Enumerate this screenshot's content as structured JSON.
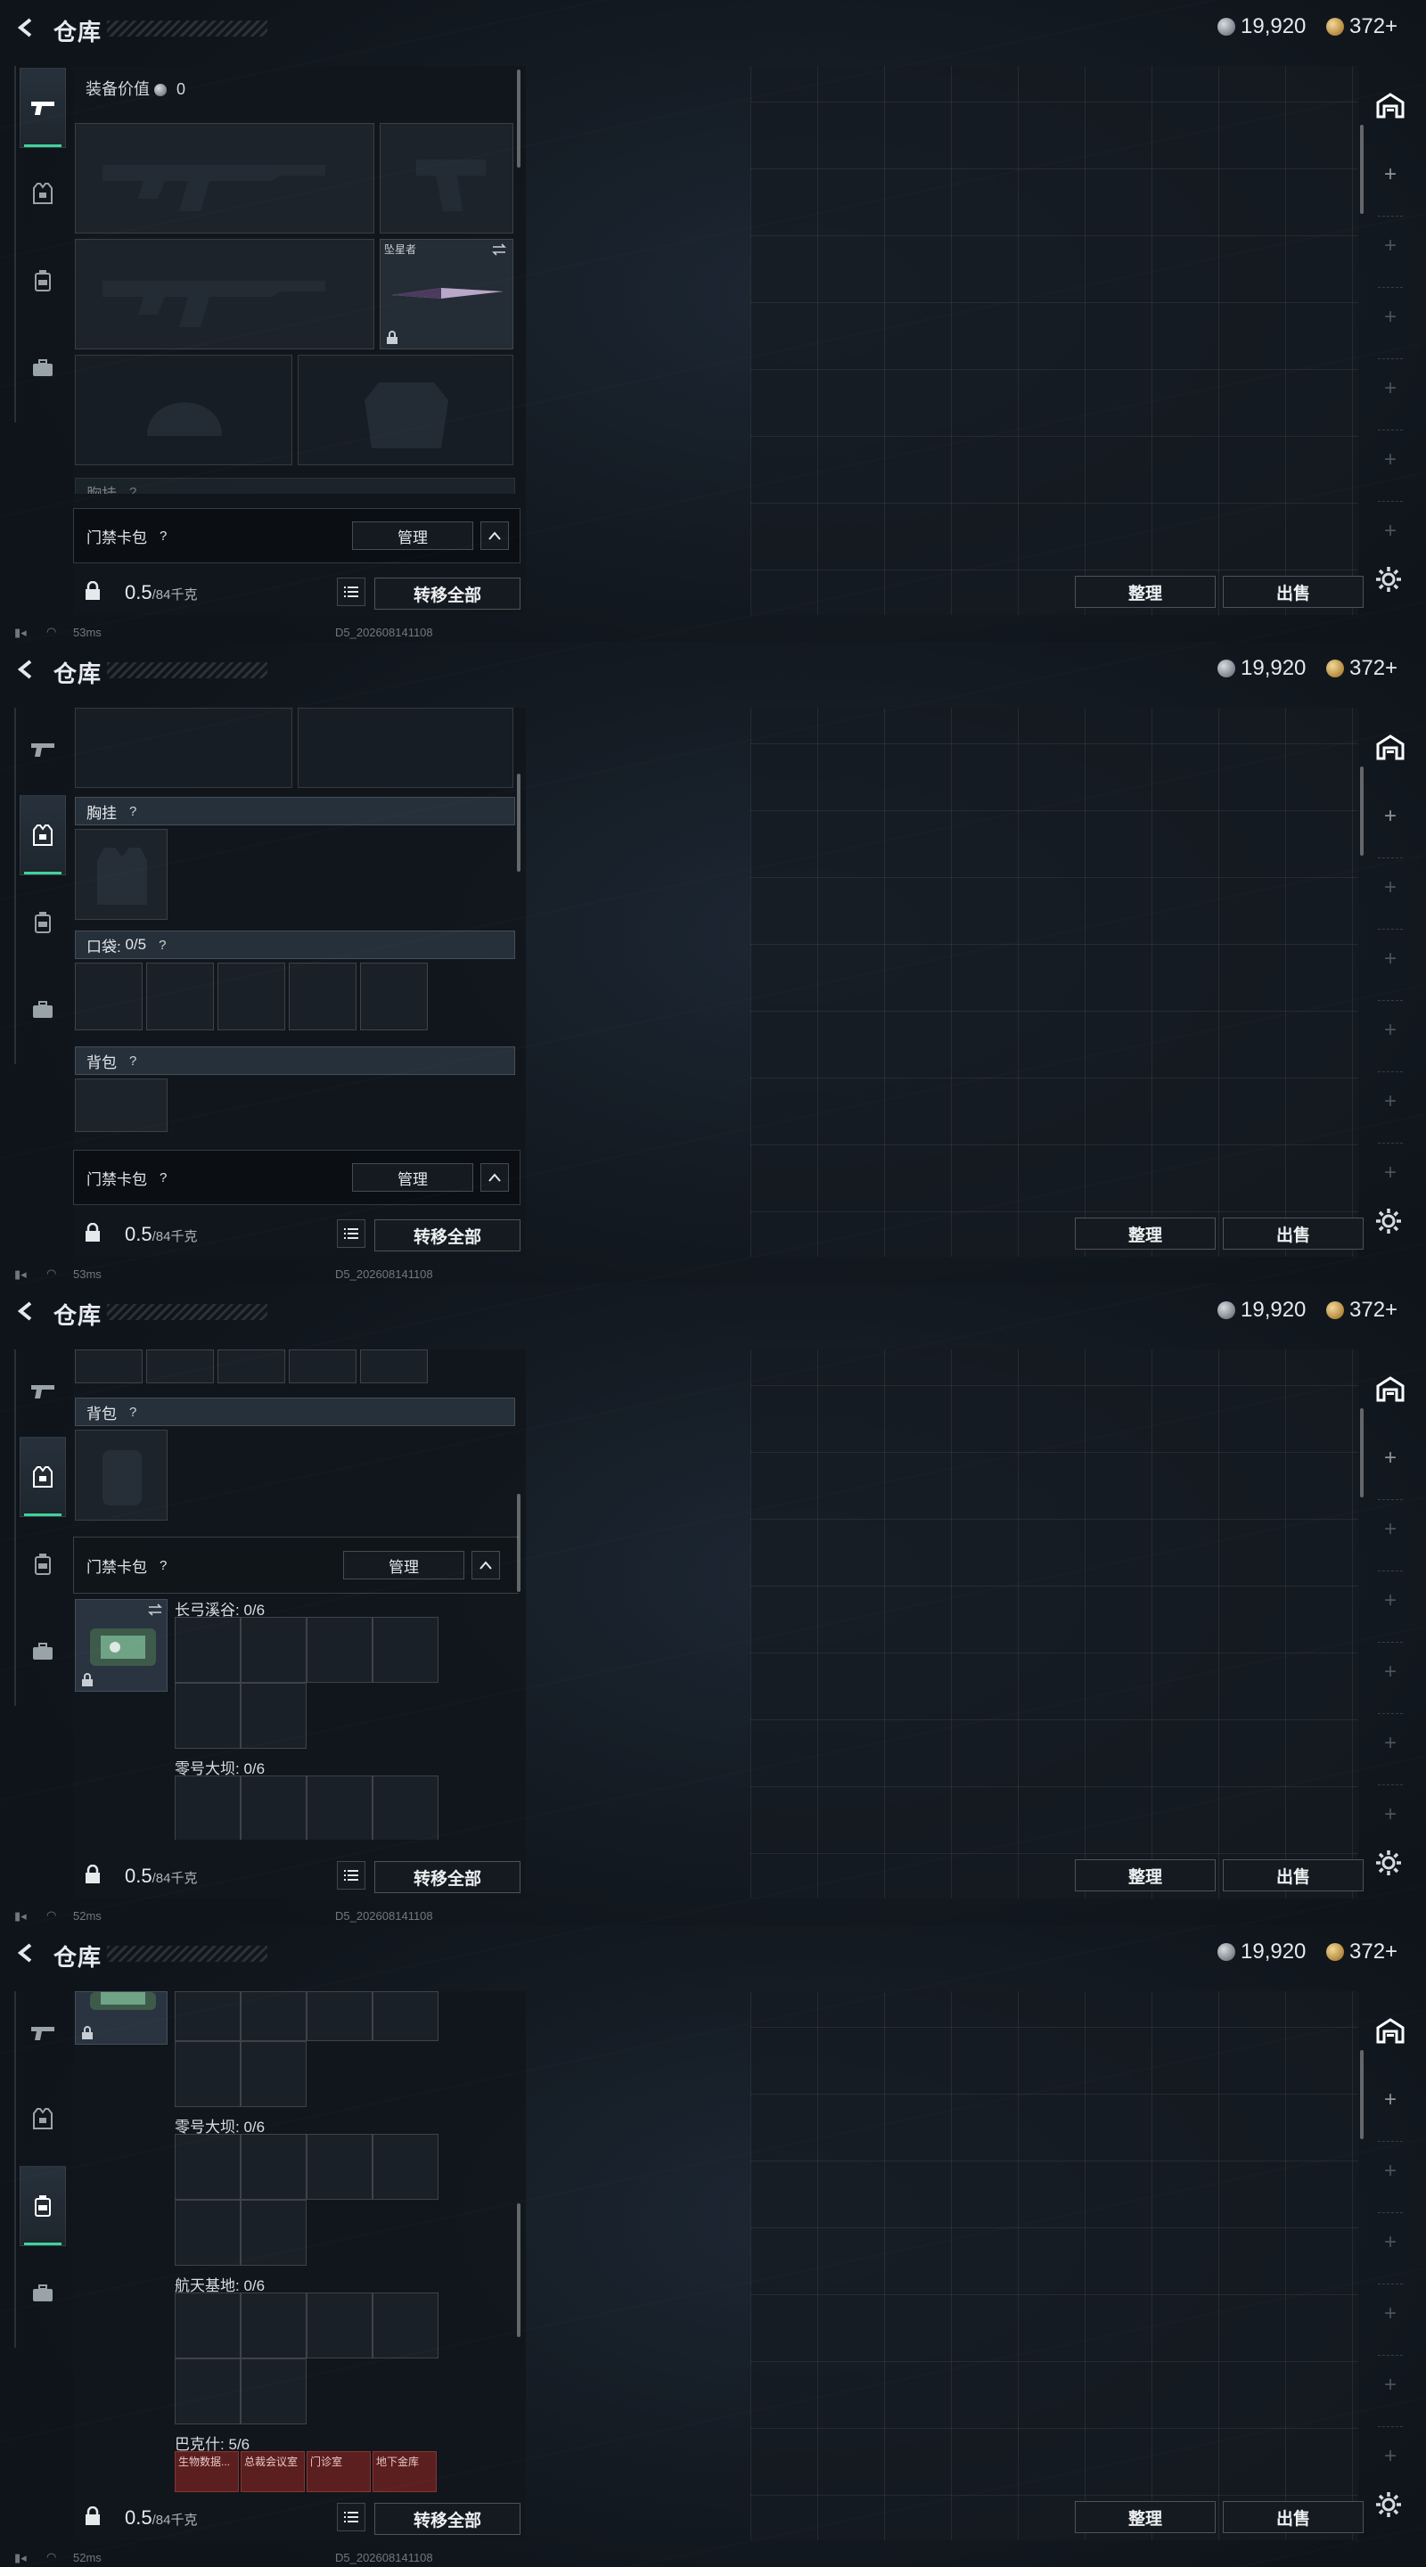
{
  "header": {
    "title": "仓库",
    "silver": "19,920",
    "gold": "372+"
  },
  "equipment": {
    "value_label": "装备价值",
    "value": "0",
    "knife_name": "坠星者"
  },
  "sections": {
    "chest_rig": "胸挂",
    "pockets": "口袋:",
    "pockets_count": "0/5",
    "backpack": "背包",
    "help_mark": "?"
  },
  "keycard_bar": {
    "label": "门禁卡包",
    "help_mark": "?",
    "manage_label": "管理"
  },
  "keycard_slots": [
    {
      "name": "长弓溪谷: 0/6"
    },
    {
      "name": "零号大坝: 0/6"
    },
    {
      "name": "航天基地: 0/6"
    },
    {
      "name": "巴克什: 5/6"
    }
  ],
  "bakesh_cards": [
    "生物数据...",
    "总裁会议室",
    "门诊室",
    "地下金库"
  ],
  "footer": {
    "weight": "0.5",
    "weight_unit": "/84千克",
    "transfer_all": "转移全部"
  },
  "storage": {
    "sort_label": "整理",
    "sell_label": "出售"
  },
  "status": [
    {
      "ping": "53ms",
      "version": "D5_202608141108"
    },
    {
      "ping": "53ms",
      "version": "D5_202608141108"
    },
    {
      "ping": "52ms",
      "version": "D5_202608141108"
    },
    {
      "ping": "52ms",
      "version": "D5_202608141108"
    }
  ],
  "icons": {
    "back": "back-arrow-icon",
    "rail": [
      "gun-icon",
      "vest-icon",
      "backpack-icon",
      "briefcase-icon"
    ],
    "storage_home": "warehouse-icon",
    "settings": "gear-icon",
    "lock": "lock-icon",
    "swap": "swap-icon",
    "list": "list-icon"
  },
  "colors": {
    "accent": "#3fd39a",
    "card_red": "#5c1f1f"
  }
}
